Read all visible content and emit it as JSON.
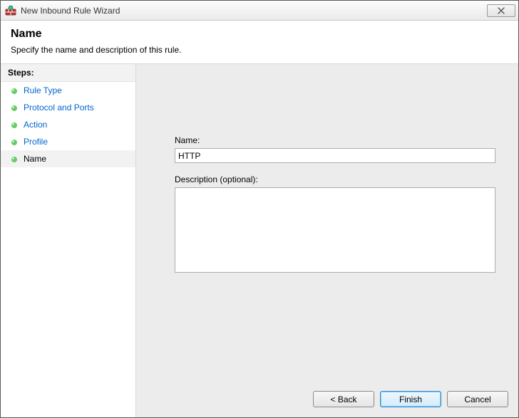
{
  "window": {
    "title": "New Inbound Rule Wizard"
  },
  "header": {
    "title": "Name",
    "subtitle": "Specify the name and description of this rule."
  },
  "sidebar": {
    "heading": "Steps:",
    "items": [
      {
        "label": "Rule Type"
      },
      {
        "label": "Protocol and Ports"
      },
      {
        "label": "Action"
      },
      {
        "label": "Profile"
      },
      {
        "label": "Name"
      }
    ],
    "current_index": 4
  },
  "form": {
    "name_label": "Name:",
    "name_value": "HTTP",
    "description_label": "Description (optional):",
    "description_value": ""
  },
  "buttons": {
    "back": "< Back",
    "finish": "Finish",
    "cancel": "Cancel"
  }
}
